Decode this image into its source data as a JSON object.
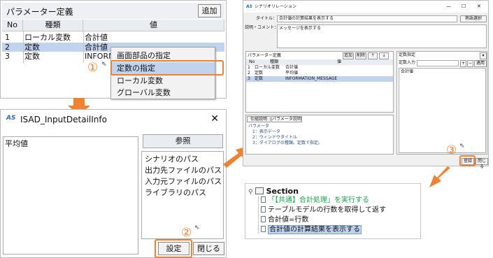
{
  "colors": {
    "accent": "#ef8231",
    "selection": "#c1d3ee",
    "header": "#e9ecf1"
  },
  "panelA": {
    "title": "パラメーター定義",
    "add_button": "追加",
    "columns": [
      "No",
      "種類",
      "値"
    ],
    "rows": [
      {
        "no": "1",
        "type": "ローカル変数",
        "value": "合計値"
      },
      {
        "no": "2",
        "type": "定数",
        "value": "合計値"
      },
      {
        "no": "3",
        "type": "定数",
        "value": "INFORM"
      }
    ],
    "context_menu": [
      "画面部品の指定",
      "定数の指定",
      "ローカル変数",
      "グローバル変数"
    ],
    "step_label": "①"
  },
  "panelB": {
    "icon_text": "AS",
    "title": "ISAD_InputDetailInfo",
    "close_glyph": "✕",
    "text_value": "平均値",
    "ref_button": "参照",
    "list_items": [
      "シナリオのパス",
      "出力先ファイルのパス",
      "入力元ファイルのパス",
      "ライブラリのパス"
    ],
    "set_button": "設定",
    "close_button": "閉じる",
    "step_label": "②"
  },
  "panelC": {
    "icon_text": "AS",
    "title": "シナリオリレーション",
    "window_controls": [
      "—",
      "☐",
      "✕"
    ],
    "title_label": "タイトル：",
    "title_value": "合計値の計算結果を表示する",
    "theme_button": "熟語選択",
    "comment_label": "説明・コメント：",
    "comment_value": "メッセージを表示する",
    "param_title": "パラメーター定義",
    "param_buttons": [
      "追加",
      "削除",
      "↑",
      "↓"
    ],
    "param_columns": [
      "No",
      "種類",
      "値"
    ],
    "param_rows": [
      {
        "no": "1",
        "type": "ローカル変数",
        "value": "合計値"
      },
      {
        "no": "2",
        "type": "定数",
        "value": "平均値"
      },
      {
        "no": "3",
        "type": "定数",
        "value": "INFORMATION_MESSAGE"
      }
    ],
    "const_title": "定数指定",
    "const_input_label": "定数入力",
    "const_buttons": [
      "+",
      "−",
      "適用"
    ],
    "const_value": "合計値",
    "tabs": [
      "仕組説明",
      "パラメータ説明"
    ],
    "desc_lines": [
      "パラメータ",
      "　1：表示データ",
      "　2：ウィンドウタイトル",
      "　3：ダイアログの種類。定数で指定。"
    ],
    "register_button": "登録",
    "close_button": "閉じる",
    "step_label": "③"
  },
  "panelD": {
    "root": "Section",
    "nodes": [
      "「【共通】合計処理」を実行する",
      "テーブルモデルの行数を取得して返す",
      "合計値=行数",
      "合計値の計算結果を表示する"
    ]
  }
}
